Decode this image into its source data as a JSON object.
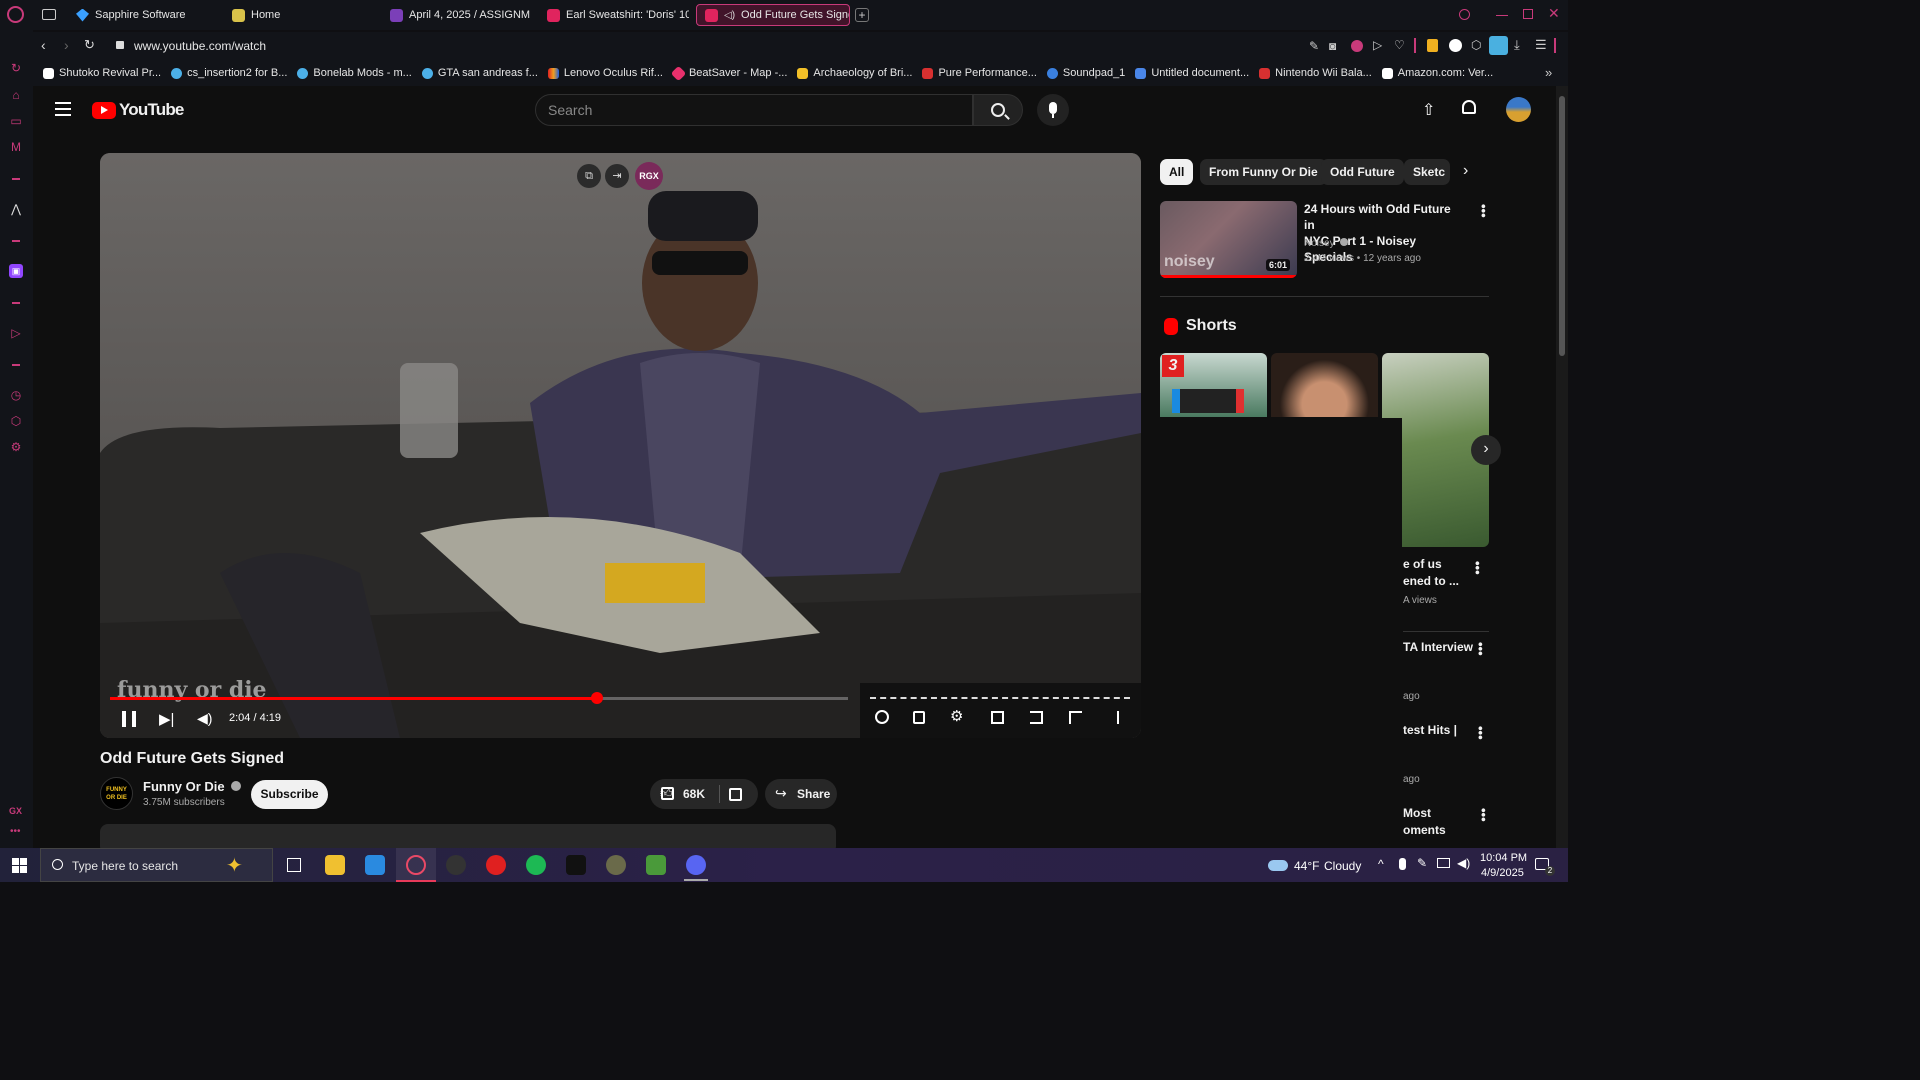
{
  "browser": {
    "tabs": [
      {
        "label": "Sapphire Software",
        "color": "#3aa0ff"
      },
      {
        "label": "Home",
        "color": "#d8c24a"
      },
      {
        "label": "April 4, 2025 / ASSIGNM",
        "color": "#7b3fb8"
      },
      {
        "label": "Earl Sweatshirt: 'Doris' 10",
        "color": "#e0245e"
      },
      {
        "label": "Odd Future Gets Signe",
        "color": "#e0245e"
      }
    ],
    "url": "www.youtube.com/watch",
    "bookmarks": [
      {
        "label": "Shutoko Revival Pr...",
        "color": "#ffffff"
      },
      {
        "label": "cs_insertion2 for B...",
        "color": "#4cb0e8"
      },
      {
        "label": "Bonelab Mods - m...",
        "color": "#4cb0e8"
      },
      {
        "label": "GTA san andreas f...",
        "color": "#4cb0e8"
      },
      {
        "label": "Lenovo Oculus Rif...",
        "color": "#f0a020"
      },
      {
        "label": "BeatSaver - Map -...",
        "color": "#e8306c"
      },
      {
        "label": "Archaeology of Bri...",
        "color": "#f2c028"
      },
      {
        "label": "Pure Performance...",
        "color": "#d83030"
      },
      {
        "label": "Soundpad_1",
        "color": "#3a80e0"
      },
      {
        "label": "Untitled document...",
        "color": "#4a86e8"
      },
      {
        "label": "Nintendo Wii Bala...",
        "color": "#d83030"
      },
      {
        "label": "Amazon.com: Ver...",
        "color": "#ffffff"
      }
    ]
  },
  "youtube": {
    "logo": "YouTube",
    "search_placeholder": "Search",
    "video": {
      "title": "Odd Future Gets Signed",
      "time_current": "2:04",
      "time_total": "4:19",
      "progress": 0.66,
      "watermark": "funny or die",
      "overlay_badge": "RGX",
      "channel": "Funny Or Die",
      "channel_avatar_text": "FUNNY OR DIE",
      "subscribers": "3.75M subscribers",
      "subscribe_label": "Subscribe",
      "likes": "68K",
      "share_label": "Share"
    },
    "chips": [
      "All",
      "From Funny Or Die",
      "Odd Future",
      "Sketc"
    ],
    "recommendation": {
      "title_line1": "24 Hours with Odd Future in",
      "title_line2": "NYC Part 1 - Noisey Specials",
      "channel": "Noisey",
      "views": "2.4M views",
      "age": "12 years ago",
      "duration": "6:01",
      "thumb_brand": "noisey"
    },
    "shorts": {
      "heading": "Shorts",
      "badge": "3"
    },
    "partial_items": [
      {
        "line1": "e of us",
        "line2": "ened to ...",
        "line3": "A views"
      },
      {
        "line1": "TA Interview",
        "line2": "ago"
      },
      {
        "line1": "test Hits |",
        "line2": "ago"
      },
      {
        "line1": "Most",
        "line2": "oments"
      }
    ]
  },
  "taskbar": {
    "search_placeholder": "Type here to search",
    "weather_temp": "44°F",
    "weather_text": "Cloudy",
    "time": "10:04 PM",
    "date": "4/9/2025",
    "notif_count": "2"
  },
  "rail_label": "GX"
}
